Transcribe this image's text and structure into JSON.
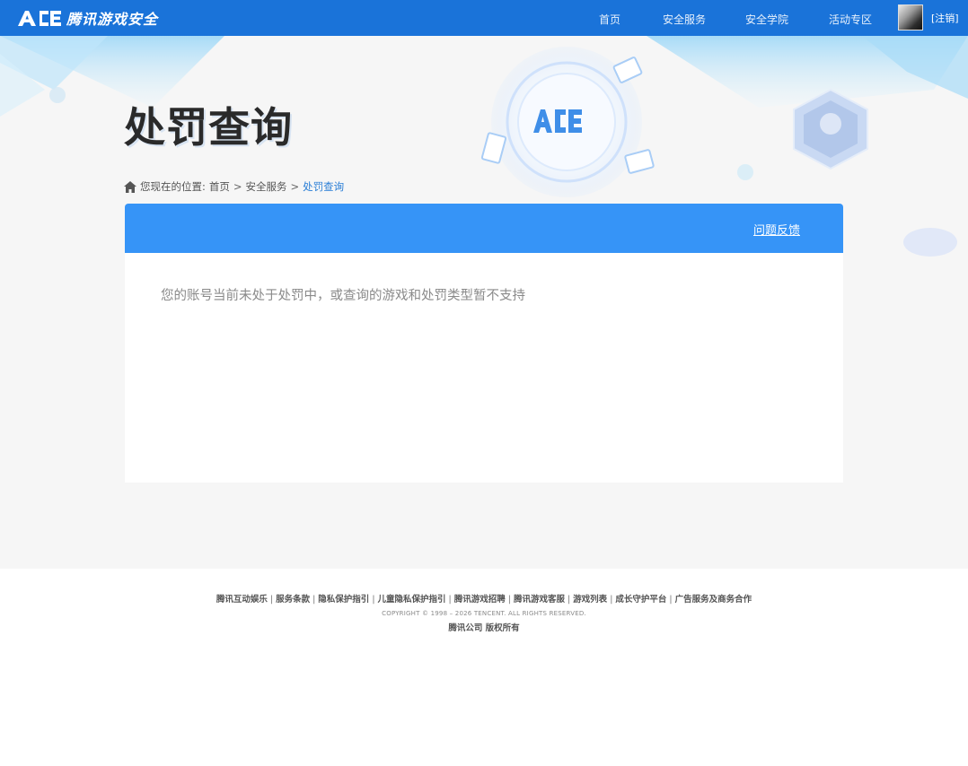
{
  "header": {
    "logo_text": "腾讯游戏安全",
    "nav": [
      {
        "label": "首页"
      },
      {
        "label": "安全服务"
      },
      {
        "label": "安全学院"
      },
      {
        "label": "活动专区"
      }
    ],
    "logout_label": "[注销]"
  },
  "banner": {
    "page_title": "处罚查询",
    "breadcrumb": {
      "prefix": "您现在的位置:",
      "items": [
        "首页",
        "安全服务"
      ],
      "current": "处罚查询",
      "separator": ">"
    }
  },
  "panel": {
    "feedback_label": "问题反馈",
    "message": "您的账号当前未处于处罚中，或查询的游戏和处罚类型暂不支持"
  },
  "footer": {
    "links": [
      "腾讯互动娱乐",
      "服务条款",
      "隐私保护指引",
      "儿童隐私保护指引",
      "腾讯游戏招聘",
      "腾讯游戏客服",
      "游戏列表",
      "成长守护平台",
      "广告服务及商务合作"
    ],
    "separator": "|",
    "copyright": "COPYRIGHT © 1998 – 2026 TENCENT. ALL RIGHTS RESERVED.",
    "company": "腾讯公司 版权所有"
  },
  "colors": {
    "topbar": "#1a73d9",
    "panel_header": "#3694f7",
    "breadcrumb_current": "#2b7fd6",
    "page_bg": "#f6f6f6"
  },
  "icons": [
    "ace-logo-icon",
    "home-icon",
    "avatar-image"
  ]
}
